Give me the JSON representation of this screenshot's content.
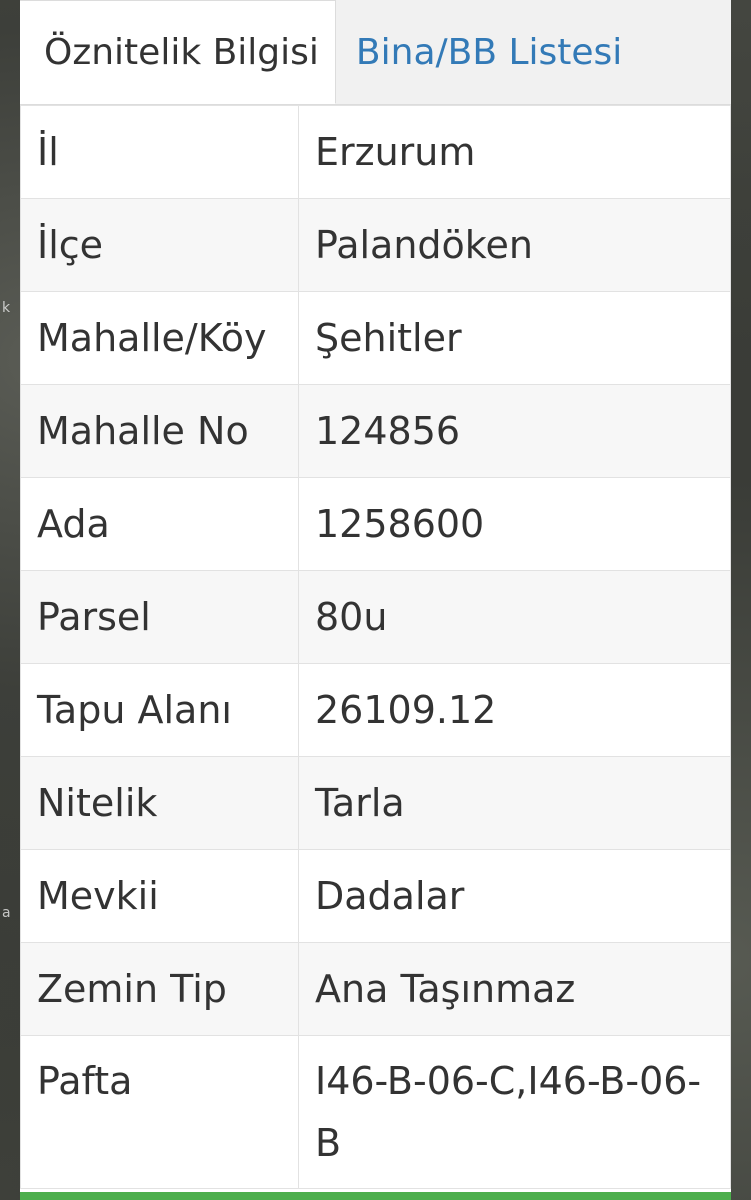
{
  "tabs": [
    {
      "label": "Öznitelik Bilgisi",
      "active": true
    },
    {
      "label": "Bina/BB Listesi",
      "active": false
    }
  ],
  "attributes": [
    {
      "key": "İl",
      "value": "Erzurum"
    },
    {
      "key": "İlçe",
      "value": "Palandöken"
    },
    {
      "key": "Mahalle/Köy",
      "value": "Şehitler"
    },
    {
      "key": "Mahalle No",
      "value": "124856"
    },
    {
      "key": "Ada",
      "value": "1258600"
    },
    {
      "key": "Parsel",
      "value": "80u"
    },
    {
      "key": "Tapu Alanı",
      "value": "26109.12"
    },
    {
      "key": "Nitelik",
      "value": "Tarla"
    },
    {
      "key": "Mevkii",
      "value": "Dadalar"
    },
    {
      "key": "Zemin Tip",
      "value": "Ana Taşınmaz"
    },
    {
      "key": "Pafta",
      "value": "I46-B-06-C,I46-B-06-B"
    }
  ],
  "colors": {
    "tab_link": "#337ab7",
    "accent_bar": "#4cae4c"
  }
}
